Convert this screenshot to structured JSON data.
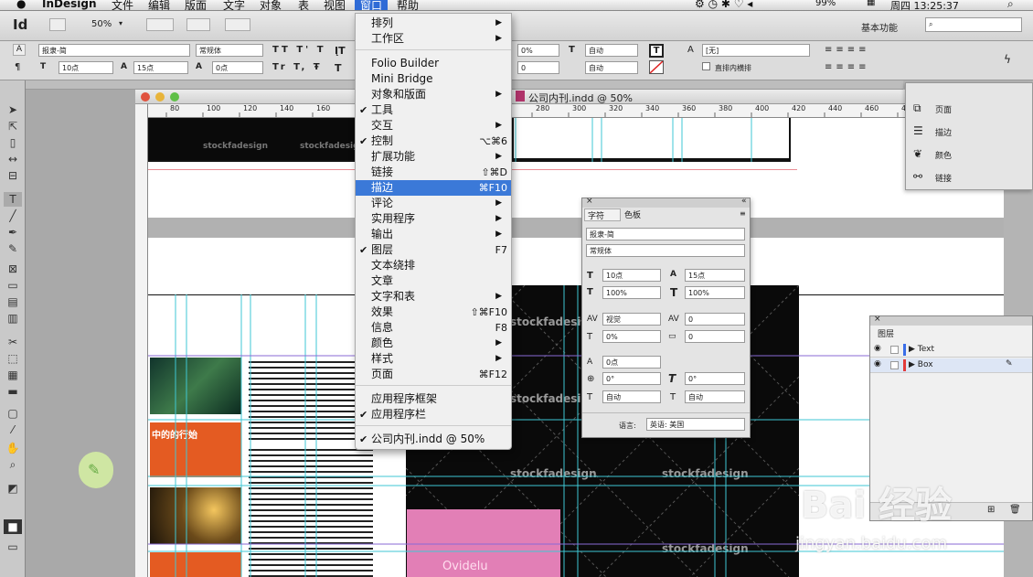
{
  "menubar": {
    "app": "InDesign",
    "items": [
      "文件",
      "编辑",
      "版面",
      "文字",
      "对象",
      "表",
      "视图",
      "窗口",
      "帮助"
    ],
    "active": "窗口",
    "battery": "99%",
    "clock": "周四 13:25:37"
  },
  "control": {
    "zoom": "50%",
    "font_family": "报隶-简",
    "font_style": "常规体",
    "font_size": "10点",
    "leading": "15点",
    "kerning": "0点",
    "tracking_pct": "0%",
    "auto1": "自动",
    "auto2": "自动",
    "stroke_label": "[无]",
    "line_through_label": "直排内横排",
    "workspace": "基本功能"
  },
  "doc": {
    "title": "公司内刊.indd @ 50%",
    "ruler": [
      "80",
      "100",
      "120",
      "140",
      "160",
      "280",
      "300",
      "320",
      "340",
      "360",
      "380",
      "400",
      "420",
      "440",
      "460",
      "480"
    ]
  },
  "window_menu": {
    "items": [
      {
        "label": "排列",
        "arrow": true
      },
      {
        "label": "工作区",
        "arrow": true
      },
      {
        "label": "Folio Builder"
      },
      {
        "label": "Mini Bridge"
      },
      {
        "label": "对象和版面",
        "arrow": true
      },
      {
        "label": "工具",
        "check": true
      },
      {
        "label": "交互",
        "arrow": true
      },
      {
        "label": "控制",
        "check": true,
        "shortcut": "⌥⌘6"
      },
      {
        "label": "扩展功能",
        "arrow": true
      },
      {
        "label": "链接",
        "shortcut": "⇧⌘D"
      },
      {
        "label": "描边",
        "shortcut": "⌘F10",
        "highlight": true
      },
      {
        "label": "评论",
        "arrow": true
      },
      {
        "label": "实用程序",
        "arrow": true
      },
      {
        "label": "输出",
        "arrow": true
      },
      {
        "label": "图层",
        "check": true,
        "shortcut": "F7"
      },
      {
        "label": "文本绕排"
      },
      {
        "label": "文章"
      },
      {
        "label": "文字和表",
        "arrow": true
      },
      {
        "label": "效果",
        "shortcut": "⇧⌘F10"
      },
      {
        "label": "信息",
        "shortcut": "F8"
      },
      {
        "label": "颜色",
        "arrow": true
      },
      {
        "label": "样式",
        "arrow": true
      },
      {
        "label": "页面",
        "shortcut": "⌘F12"
      },
      {
        "label": "应用程序框架"
      },
      {
        "label": "应用程序栏",
        "check": true
      },
      {
        "label": "公司内刊.indd @ 50%",
        "check": true
      }
    ]
  },
  "char_panel": {
    "tab1": "字符",
    "tab2": "色板",
    "font": "报隶-简",
    "style": "常规体",
    "size": "10点",
    "leading": "15点",
    "vscale": "100%",
    "hscale": "100%",
    "kern": "视觉",
    "track": "0",
    "tsume": "0%",
    "gridcount": "0",
    "baseline": "0点",
    "skew": "0°",
    "rotate": "0°",
    "auto_a": "自动",
    "auto_b": "自动",
    "lang_label": "语言:",
    "lang": "英语: 美国"
  },
  "right_panel": {
    "items": [
      "页面",
      "描边",
      "颜色",
      "链接"
    ]
  },
  "layers_panel": {
    "title": "图层",
    "layers": [
      "Text",
      "Box"
    ]
  },
  "canvas": {
    "watermark": "stockfadesign",
    "pink_label": "Ovidelu",
    "headline": "中的的行始"
  },
  "watermark": {
    "baidu": "Bai 经验",
    "url": "jingyan.baidu.com"
  }
}
